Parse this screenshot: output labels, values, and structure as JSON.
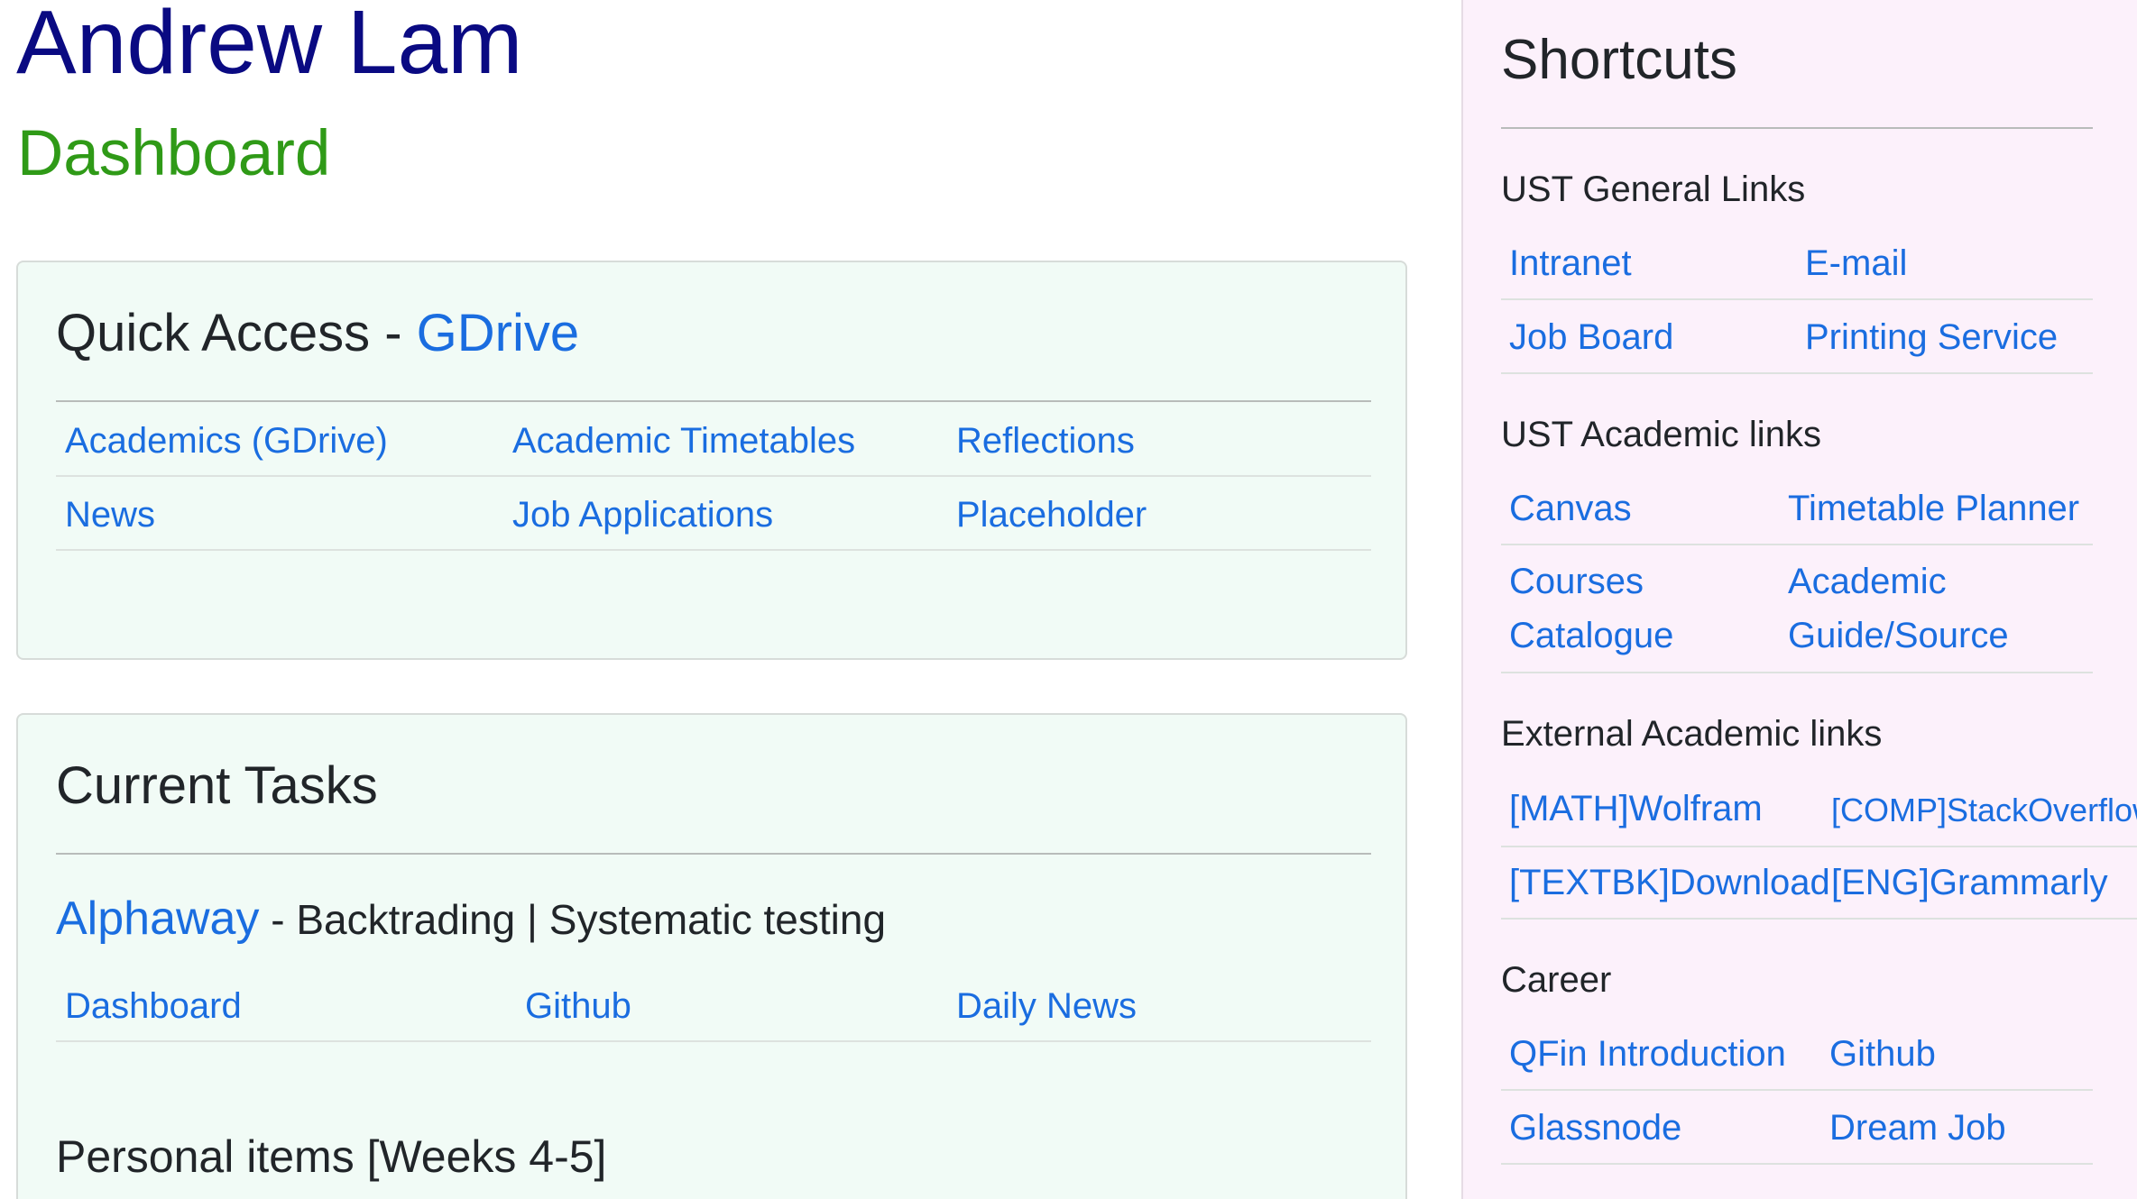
{
  "header": {
    "name": "Andrew Lam",
    "subtitle": "Dashboard"
  },
  "quick_access": {
    "title": "Quick Access - ",
    "title_link": "GDrive",
    "rows": [
      [
        "Academics (GDrive)",
        "Academic Timetables",
        "Reflections"
      ],
      [
        "News",
        "Job Applications",
        "Placeholder"
      ]
    ]
  },
  "current_tasks": {
    "title": "Current Tasks",
    "task": {
      "name": "Alphaway",
      "description": " - Backtrading | Systematic testing",
      "links": [
        "Dashboard",
        "Github",
        "Daily News"
      ]
    },
    "personal_items_title": "Personal items [Weeks 4-5]"
  },
  "sidebar": {
    "title": "Shortcuts",
    "sections": [
      {
        "heading": "UST General Links",
        "rows": [
          [
            "Intranet",
            "E-mail"
          ],
          [
            "Job Board",
            "Printing Service"
          ]
        ]
      },
      {
        "heading": "UST Academic links",
        "rows": [
          [
            "Canvas",
            "Timetable Planner"
          ],
          [
            "Courses Catalogue",
            "Academic Guide/Source"
          ]
        ]
      },
      {
        "heading": "External Academic links",
        "rows": [
          [
            "[MATH]Wolfram",
            "[COMP]StackOverflow"
          ],
          [
            "[TEXTBK]Download",
            "[ENG]Grammarly"
          ]
        ]
      },
      {
        "heading": "Career",
        "rows": [
          [
            "QFin Introduction",
            "Github"
          ],
          [
            "Glassnode",
            "Dream Job"
          ]
        ]
      }
    ]
  },
  "colors": {
    "name": "#0a0a82",
    "subtitle": "#2f9a17",
    "link": "#1a6de0",
    "card_bg": "#f1fbf6",
    "sidebar_bg": "#fcf1fb"
  }
}
